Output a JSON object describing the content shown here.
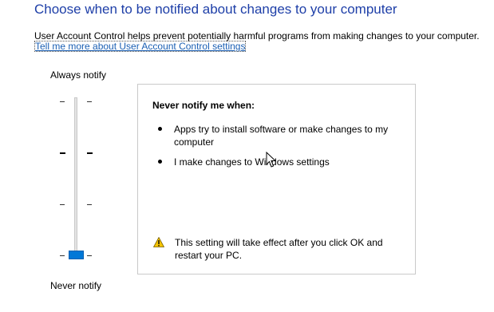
{
  "header": {
    "title": "Choose when to be notified about changes to your computer",
    "description": "User Account Control helps prevent potentially harmful programs from making changes to your computer.",
    "link": "Tell me more about User Account Control settings"
  },
  "slider": {
    "top_label": "Always notify",
    "bottom_label": "Never notify",
    "level_count": 4,
    "selected_level": 1,
    "selected_level_note": "bottom position (level 1 of 4)"
  },
  "info": {
    "title": "Never notify me when:",
    "bullets": [
      "Apps try to install software or make changes to my computer",
      "I make changes to Windows settings"
    ],
    "warning": "This setting will take effect after you click OK and restart your PC."
  },
  "colors": {
    "heading": "#1e3fa8",
    "link": "#1a5fb4",
    "thumb": "#0078d7",
    "warning_icon": "#f5c400"
  },
  "icons": {
    "warning": "warning-triangle-icon",
    "cursor": "mouse-pointer-icon"
  }
}
